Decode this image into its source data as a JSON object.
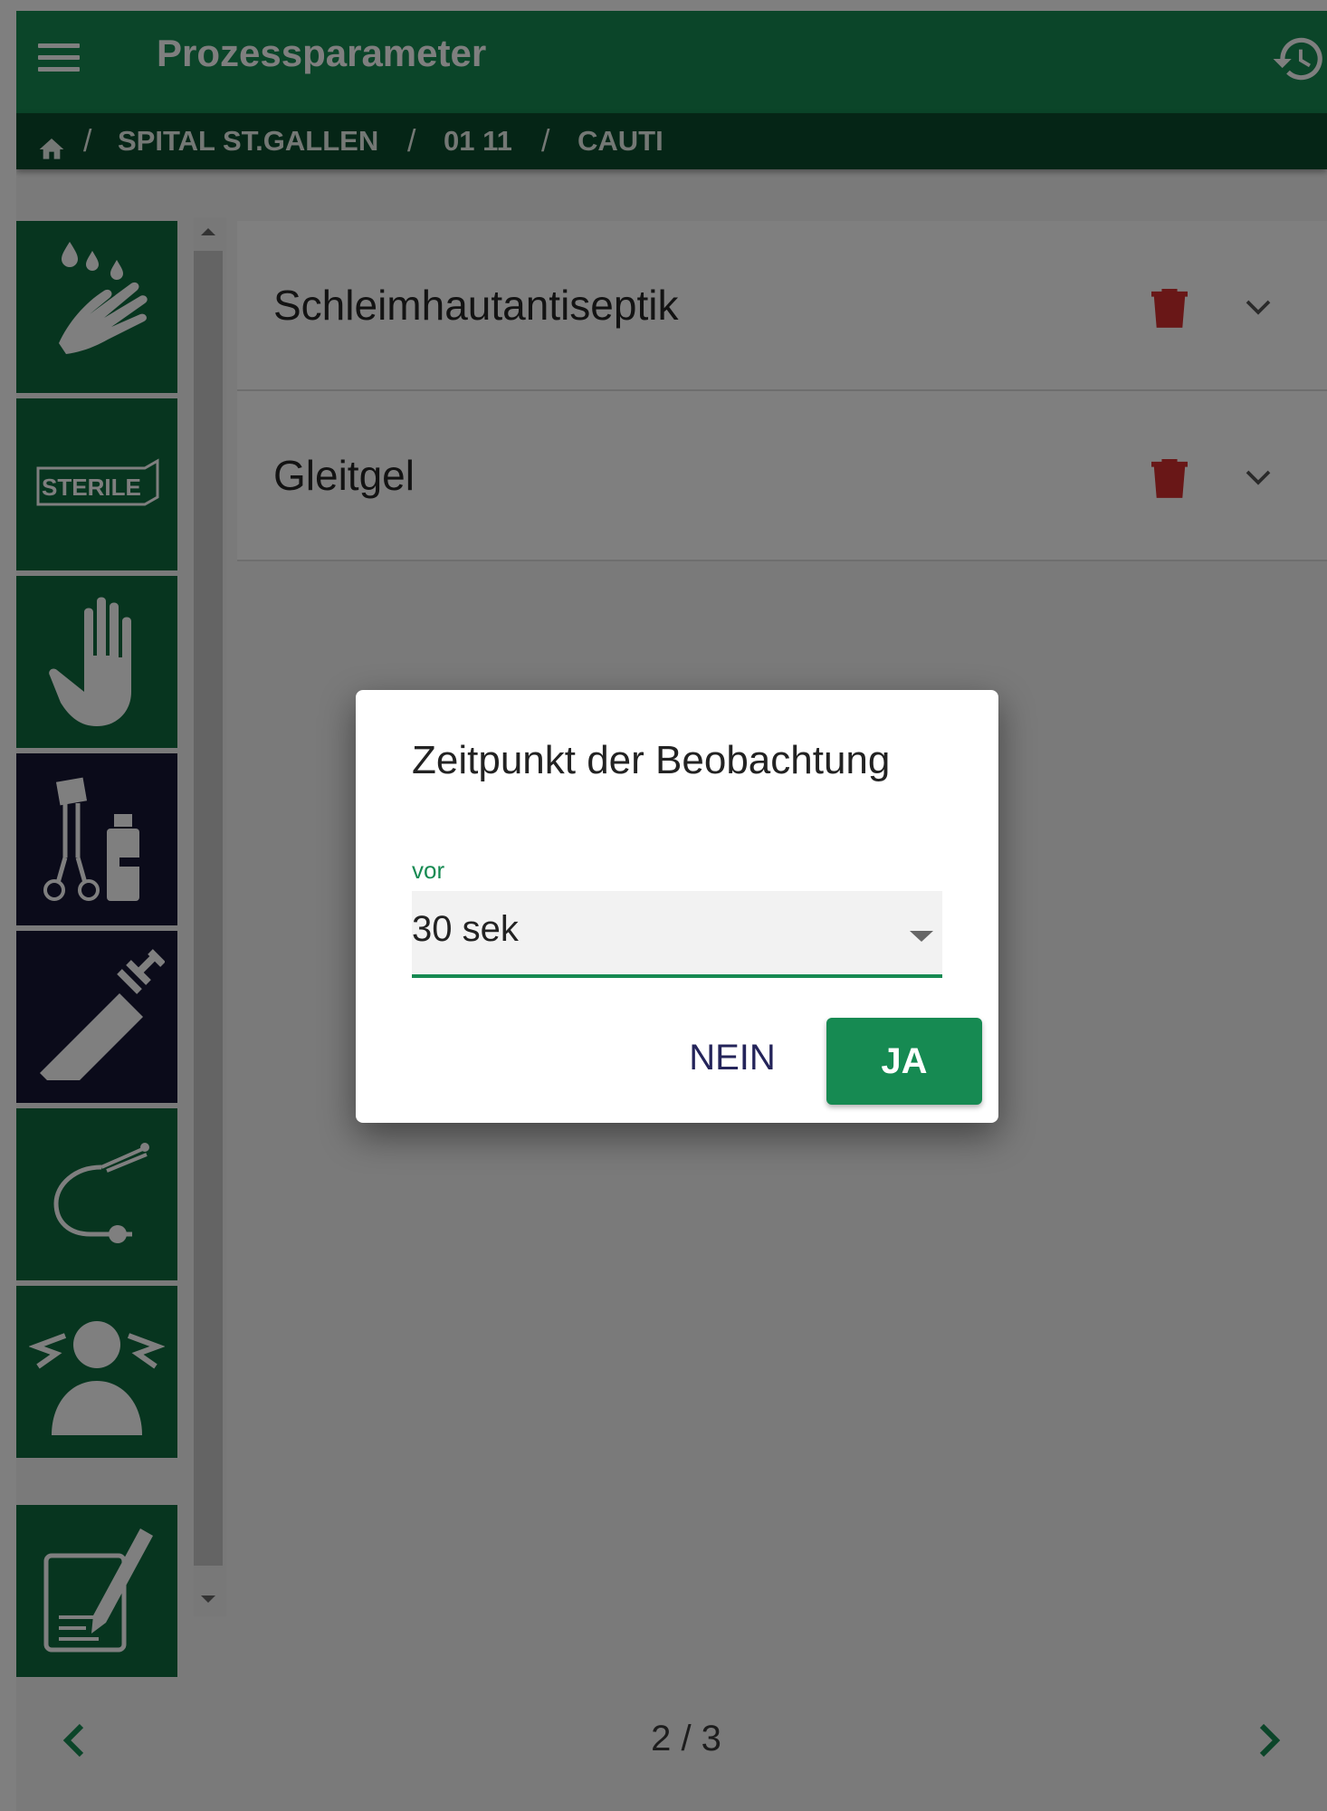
{
  "header": {
    "title": "Prozessparameter",
    "menu_icon": "hamburger-menu-icon",
    "history_icon": "history-icon"
  },
  "breadcrumb": {
    "home_icon": "home-icon",
    "items": [
      "SPITAL ST.GALLEN",
      "01 11",
      "CAUTI"
    ],
    "separator": "/"
  },
  "sidebar": {
    "items": [
      {
        "icon": "hand-disinfection-icon",
        "label": ""
      },
      {
        "icon": "sterile-package-icon",
        "label": "STERILE"
      },
      {
        "icon": "hand-glove-icon",
        "label": ""
      },
      {
        "icon": "instruments-bottle-icon",
        "label": ""
      },
      {
        "icon": "syringe-icon",
        "label": ""
      },
      {
        "icon": "catheter-icon",
        "label": ""
      },
      {
        "icon": "patient-alert-icon",
        "label": ""
      },
      {
        "icon": "documentation-icon",
        "label": ""
      }
    ]
  },
  "cards": [
    {
      "label": "Schleimhautantiseptik"
    },
    {
      "label": "Gleitgel"
    }
  ],
  "pager": {
    "text": "2 / 3"
  },
  "dialog": {
    "title": "Zeitpunkt der Beobachtung",
    "field_label": "vor",
    "select_value": "30 sek",
    "cancel_label": "NEIN",
    "confirm_label": "JA"
  },
  "colors": {
    "primary": "#168a52",
    "primary_dark": "#0b4a2c",
    "sidebar_green": "#0f6a3e",
    "sidebar_dark": "#161634",
    "delete": "#d32f2f"
  }
}
